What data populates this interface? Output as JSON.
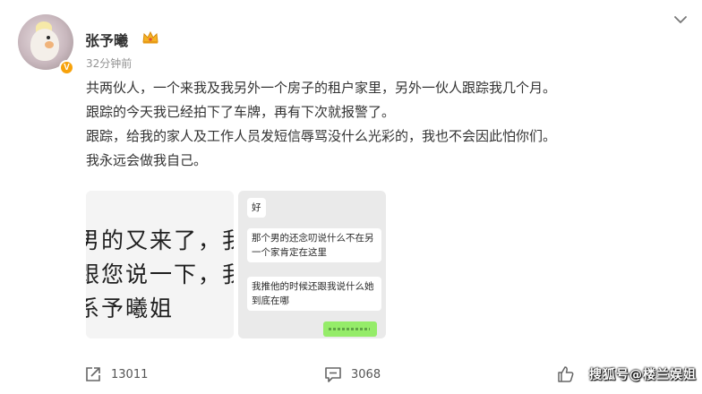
{
  "post": {
    "author": "张予曦",
    "time": "32分钟前",
    "lines": [
      "共两伙人，一个来我及我另外一个房子的租户家里，另外一伙人跟踪我几个月。",
      "跟踪的今天我已经拍下了车牌，再有下次就报警了。",
      "跟踪，给我的家人及工作人员发短信辱骂没什么光彩的，我也不会因此怕你们。",
      "我永远会做我自己。"
    ],
    "badge_icon": "verified-v-icon",
    "crown_icon": "crown-icon"
  },
  "images": {
    "first": {
      "lines": [
        "男的又来了，我",
        "跟您说一下，我",
        "系予曦姐"
      ]
    },
    "second": {
      "bubbles": [
        "好",
        "那个男的还念叨说什么不在另一个家肯定在这里",
        "我推他的时候还跟我说什么她到底在哪"
      ]
    }
  },
  "actions": {
    "share_count": "13011",
    "comment_count": "3068",
    "watermark": "搜狐号@楼兰娱姐"
  },
  "colors": {
    "text": "#333333",
    "muted": "#939393",
    "badge": "#f7a20b",
    "chat_green": "#95ec69"
  }
}
